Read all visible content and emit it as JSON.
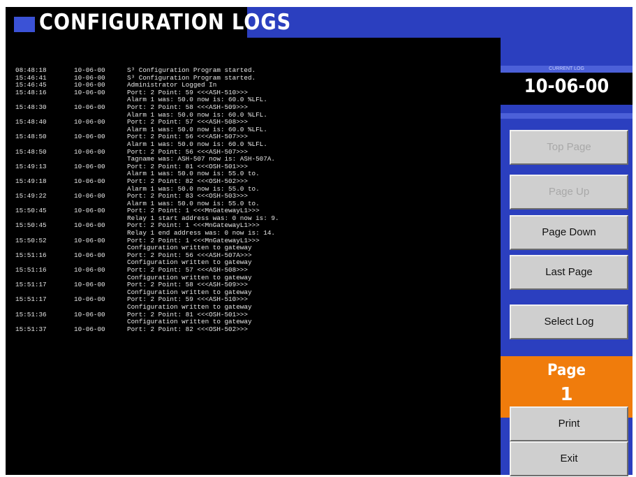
{
  "title": "CONFIGURATION LOGS",
  "current_log": {
    "label": "CURRENT LOG",
    "value": "10-06-00"
  },
  "buttons": {
    "top_page": "Top Page",
    "page_up": "Page Up",
    "page_down": "Page Down",
    "last_page": "Last Page",
    "select_log": "Select Log",
    "print": "Print",
    "exit": "Exit"
  },
  "page": {
    "label": "Page",
    "number": "1"
  },
  "log_rows": [
    {
      "time": "08:48:18",
      "date": "10-06-00",
      "text": "S³ Configuration Program started."
    },
    {
      "time": "15:46:41",
      "date": "10-06-00",
      "text": "S³ Configuration Program started."
    },
    {
      "time": "15:46:45",
      "date": "10-06-00",
      "text": "Administrator Logged In"
    },
    {
      "time": "15:48:16",
      "date": "10-06-00",
      "text": "Port: 2 Point: 59 <<<ASH-510>>>"
    },
    {
      "time": "",
      "date": "",
      "text": "",
      "detail": "Alarm 1 was: 50.0 now is: 60.0 %LFL."
    },
    {
      "time": "15:48:30",
      "date": "10-06-00",
      "text": "Port: 2 Point: 58 <<<ASH-509>>>"
    },
    {
      "time": "",
      "date": "",
      "text": "",
      "detail": "Alarm 1 was: 50.0 now is: 60.0 %LFL."
    },
    {
      "time": "15:48:40",
      "date": "10-06-00",
      "text": "Port: 2 Point: 57 <<<ASH-508>>>"
    },
    {
      "time": "",
      "date": "",
      "text": "",
      "detail": "Alarm 1 was: 50.0 now is: 60.0 %LFL."
    },
    {
      "time": "15:48:50",
      "date": "10-06-00",
      "text": "Port: 2 Point: 56 <<<ASH-507>>>"
    },
    {
      "time": "",
      "date": "",
      "text": "",
      "detail": "Alarm 1 was: 50.0 now is: 60.0 %LFL."
    },
    {
      "time": "15:48:50",
      "date": "10-06-00",
      "text": "Port: 2 Point: 56 <<<ASH-507>>>"
    },
    {
      "time": "",
      "date": "",
      "text": "",
      "detail": "Tagname was: ASH-507 now is: ASH-507A."
    },
    {
      "time": "15:49:13",
      "date": "10-06-00",
      "text": "Port: 2 Point: 81 <<<OSH-501>>>"
    },
    {
      "time": "",
      "date": "",
      "text": "",
      "detail": "Alarm 1 was: 50.0 now is: 55.0 to."
    },
    {
      "time": "15:49:18",
      "date": "10-06-00",
      "text": "Port: 2 Point: 82 <<<OSH-502>>>"
    },
    {
      "time": "",
      "date": "",
      "text": "",
      "detail": "Alarm 1 was: 50.0 now is: 55.0 to."
    },
    {
      "time": "15:49:22",
      "date": "10-06-00",
      "text": "Port: 2 Point: 83 <<<OSH-503>>>"
    },
    {
      "time": "",
      "date": "",
      "text": "",
      "detail": "Alarm 1 was: 50.0 now is: 55.0 to."
    },
    {
      "time": "15:50:45",
      "date": "10-06-00",
      "text": "Port: 2 Point: 1 <<<MnGatewayL1>>>"
    },
    {
      "time": "",
      "date": "",
      "text": "",
      "detail": "Relay 1 start address was: 0 now is: 9."
    },
    {
      "time": "15:50:45",
      "date": "10-06-00",
      "text": "Port: 2 Point: 1 <<<MnGatewayL1>>>"
    },
    {
      "time": "",
      "date": "",
      "text": "",
      "detail": "Relay 1 end address was: 0 now is: 14."
    },
    {
      "time": "15:50:52",
      "date": "10-06-00",
      "text": "Port: 2 Point: 1 <<<MnGatewayL1>>>"
    },
    {
      "time": "",
      "date": "",
      "text": "",
      "detail": "Configuration written to gateway"
    },
    {
      "time": "15:51:16",
      "date": "10-06-00",
      "text": "Port: 2 Point: 56 <<<ASH-507A>>>"
    },
    {
      "time": "",
      "date": "",
      "text": "",
      "detail": "Configuration written to gateway"
    },
    {
      "time": "15:51:16",
      "date": "10-06-00",
      "text": "Port: 2 Point: 57 <<<ASH-508>>>"
    },
    {
      "time": "",
      "date": "",
      "text": "",
      "detail": "Configuration written to gateway"
    },
    {
      "time": "15:51:17",
      "date": "10-06-00",
      "text": "Port: 2 Point: 58 <<<ASH-509>>>"
    },
    {
      "time": "",
      "date": "",
      "text": "",
      "detail": "Configuration written to gateway"
    },
    {
      "time": "15:51:17",
      "date": "10-06-00",
      "text": "Port: 2 Point: 59 <<<ASH-510>>>"
    },
    {
      "time": "",
      "date": "",
      "text": "",
      "detail": "Configuration written to gateway"
    },
    {
      "time": "15:51:36",
      "date": "10-06-00",
      "text": "Port: 2 Point: 81 <<<OSH-501>>>"
    },
    {
      "time": "",
      "date": "",
      "text": "",
      "detail": "Configuration written to gateway"
    },
    {
      "time": "15:51:37",
      "date": "10-06-00",
      "text": "Port: 2 Point: 82 <<<OSH-502>>>"
    }
  ]
}
